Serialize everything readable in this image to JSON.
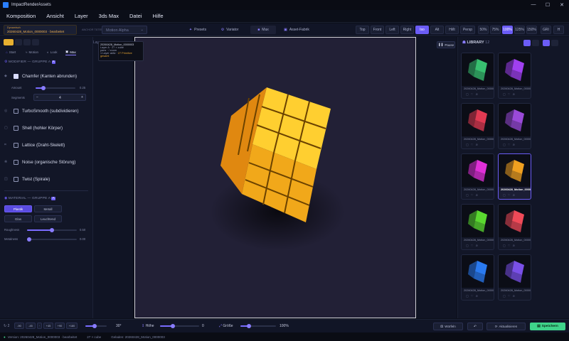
{
  "window": {
    "title": "ImpactRenderAssets",
    "controls": [
      "—",
      "☐",
      "✕"
    ]
  },
  "menu": [
    "Komposition",
    "Ansicht",
    "Layer",
    "3ds Max",
    "Datei",
    "Hilfe"
  ],
  "toolbar": {
    "project_label": "Dynamisch",
    "project_name": "20260428_Motion_0000003",
    "project_state": "bearbeitet",
    "arch_label": "ANCHOR TÄTEN",
    "arch_value": "Motion Alpha",
    "center_buttons": [
      "Presets",
      "Variator",
      "Max",
      "Asset-Fabrik"
    ],
    "views": [
      "Top",
      "Front",
      "Left",
      "Right",
      "Iso",
      "Alt",
      "Hi/lt",
      "Persp"
    ],
    "active_view": "Iso",
    "zooms": [
      "50%",
      "75%",
      "100%",
      "125%",
      "150%"
    ],
    "active_zoom": "100%",
    "extra": [
      "GRI",
      "H"
    ]
  },
  "left_panel": {
    "tabs": [
      "Start",
      "Motion",
      "Look",
      "Max"
    ],
    "active_tab": "Max",
    "modifier_header": "MODIFIER — GRUPPE A",
    "modifiers": [
      {
        "label": "Chamfer (Kanten abrunden)",
        "checked": true
      },
      {
        "label": "TurboSmooth (subdividieren)",
        "checked": false
      },
      {
        "label": "Shell (hohler Körper)",
        "checked": false
      },
      {
        "label": "Lattice (Draht-Skelett)",
        "checked": false
      },
      {
        "label": "Noise (organische Störung)",
        "checked": false
      },
      {
        "label": "Twist (Spirale)",
        "checked": false
      }
    ],
    "amount_label": "Amount",
    "amount_value": "0.25",
    "amount_level": 0.2,
    "segments_label": "Segments",
    "segments_value": "4",
    "material_header": "MATERIAL — GRUPPE A",
    "materials": [
      "Plastik",
      "Metall",
      "Glas",
      "Leuchtend"
    ],
    "active_material": "Plastik",
    "roughness_label": "Roughness",
    "roughness_value": "0.50",
    "roughness_level": 0.5,
    "metalness_label": "Metalness",
    "metalness_value": "0.00",
    "metalness_level": 0.0
  },
  "strip_label": "Lay",
  "viewport_info": {
    "name": "20260428_Motion_0000003",
    "layer": "Layer A",
    "line2": "27 × cube",
    "line3": "pans · / zoom",
    "line4": "1 Layer aktiv",
    "line5": "27 Primitive gesamt"
  },
  "pause_label": "Pause",
  "library": {
    "title": "LIBRARY",
    "count": "12",
    "items": [
      {
        "name": "20260428_Motion_0000001",
        "color": "#38c070"
      },
      {
        "name": "20260428_Motion_0000002",
        "color": "#a040f0"
      },
      {
        "name": "20260428_Motion_0000004",
        "color": "#e03a52"
      },
      {
        "name": "20260428_Motion_0000005",
        "color": "#9a4ad8"
      },
      {
        "name": "20260428_Motion_0000006",
        "color": "#e030d8"
      },
      {
        "name": "20260428_Motion_0000003",
        "color": "#f0a020",
        "selected": true
      },
      {
        "name": "20260428_Motion_0000007",
        "color": "#5ad830"
      },
      {
        "name": "20260428_Motion_0000008",
        "color": "#f04a58"
      },
      {
        "name": "20260428_Motion_0000009",
        "color": "#2a7af0"
      },
      {
        "name": "20260428_Motion_0000010",
        "color": "#7a50e8"
      }
    ]
  },
  "bottom": {
    "frame": "2",
    "steps": [
      "-90",
      "-45",
      "+45",
      "+90",
      "+180",
      "+180"
    ],
    "rotation_value": "30°",
    "hoehe_label": "Höhe",
    "hoehe_value": "0",
    "groesse_label": "Größe",
    "groesse_value": "100%",
    "wuerfeln": "Würfeln",
    "aktualisieren": "Aktualisieren",
    "speichern": "Speichern"
  },
  "status": {
    "left": "Version: 20260428_Motion_0000003 · bearbeitet",
    "mid": "27 × cube",
    "right": "Geladen: 20260428_Motion_0000003"
  },
  "colors": {
    "accent": "#6b5cf5",
    "save": "#3fd38a",
    "cube_top": "#ffd23a",
    "cube_side": "#f0a020"
  }
}
